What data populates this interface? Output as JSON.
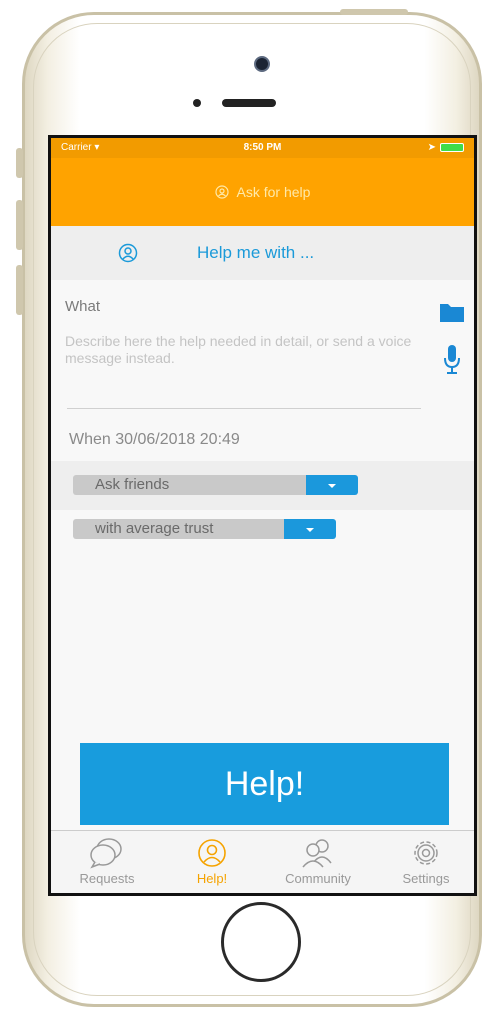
{
  "status_bar": {
    "carrier": "Carrier",
    "time": "8:50 PM"
  },
  "nav": {
    "title": "Ask for help"
  },
  "segment": {
    "label": "Help me with ..."
  },
  "form": {
    "what_label": "What",
    "description_placeholder": "Describe here the help needed in detail, or send a voice message instead.",
    "when_text": "When 30/06/2018 20:49",
    "audience_select": "Ask friends",
    "trust_select": "with average trust"
  },
  "primary_button": {
    "label": "Help!"
  },
  "tabs": [
    {
      "label": "Requests",
      "icon": "chat-bubbles-icon"
    },
    {
      "label": "Help!",
      "icon": "person-circle-icon"
    },
    {
      "label": "Community",
      "icon": "group-icon"
    },
    {
      "label": "Settings",
      "icon": "gear-icon"
    }
  ],
  "colors": {
    "nav_orange": "#ffa300",
    "accent_blue": "#1b98dc",
    "active_tab": "#f5a300"
  }
}
